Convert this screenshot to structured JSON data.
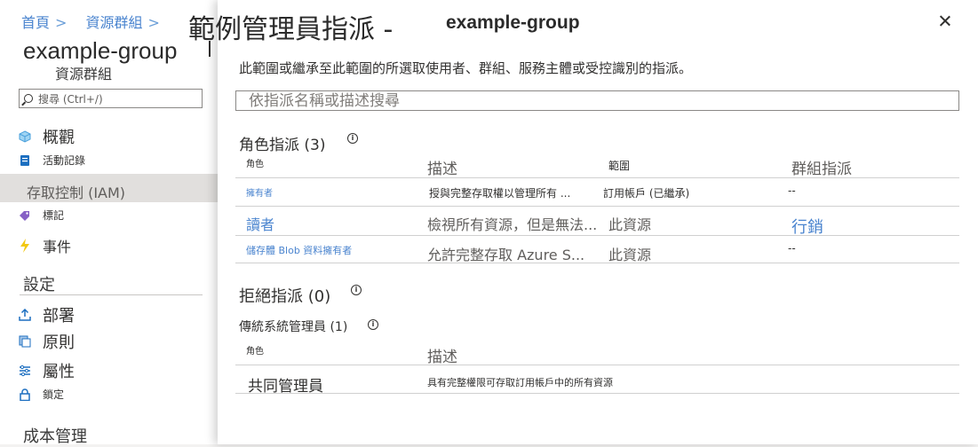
{
  "breadcrumb": [
    {
      "label": "首頁"
    },
    {
      "label": "資源群組"
    }
  ],
  "background_blade": {
    "title": "example-group",
    "subtitle": "資源群組",
    "search_placeholder": "搜尋 (Ctrl+/)",
    "nav": {
      "overview": "概觀",
      "activity_log": "活動記錄",
      "iam": "存取控制 (IAM)",
      "tags": "標記",
      "events": "事件"
    },
    "settings_header": "設定",
    "settings": {
      "deployments": "部署",
      "policies": "原則",
      "properties": "屬性",
      "locks": "鎖定"
    },
    "cost_header": "成本管理"
  },
  "panel": {
    "title": "範例管理員指派 -",
    "title_resource": "example-group",
    "description": "此範圍或繼承至此範圍的所選取使用者、群組、服務主體或受控識別的指派。",
    "search_placeholder": "依指派名稱或描述搜尋",
    "role_assignments": {
      "header": "角色指派 (3)",
      "columns": {
        "role": "角色",
        "description": "描述",
        "scope": "範圍",
        "group_assignment": "群組指派"
      },
      "rows": [
        {
          "role": "擁有者",
          "description": "授與完整存取權以管理所有 ...",
          "scope": "訂用帳戶 (已繼承)",
          "group": "--"
        },
        {
          "role": "讀者",
          "description": "檢視所有資源，但是無法...",
          "scope": "此資源",
          "group": "行銷"
        },
        {
          "role": "儲存體 Blob 資料擁有者",
          "description": "允許完整存取 Azure S...",
          "scope": "此資源",
          "group": "--"
        }
      ]
    },
    "deny_assignments": {
      "header": "拒絕指派 (0)"
    },
    "classic_admins": {
      "header": "傳統系統管理員 (1)",
      "columns": {
        "role": "角色",
        "description": "描述"
      },
      "rows": [
        {
          "role": "共同管理員",
          "description": "具有完整權限可存取訂用帳戶中的所有資源"
        }
      ]
    }
  },
  "colors": {
    "accent_link": "#4a84cf",
    "tag_icon": "#8661c5",
    "lightning_icon": "#f2c811",
    "overview_icon": "#4aa0dc",
    "activity_icon": "#1d6fc0"
  }
}
